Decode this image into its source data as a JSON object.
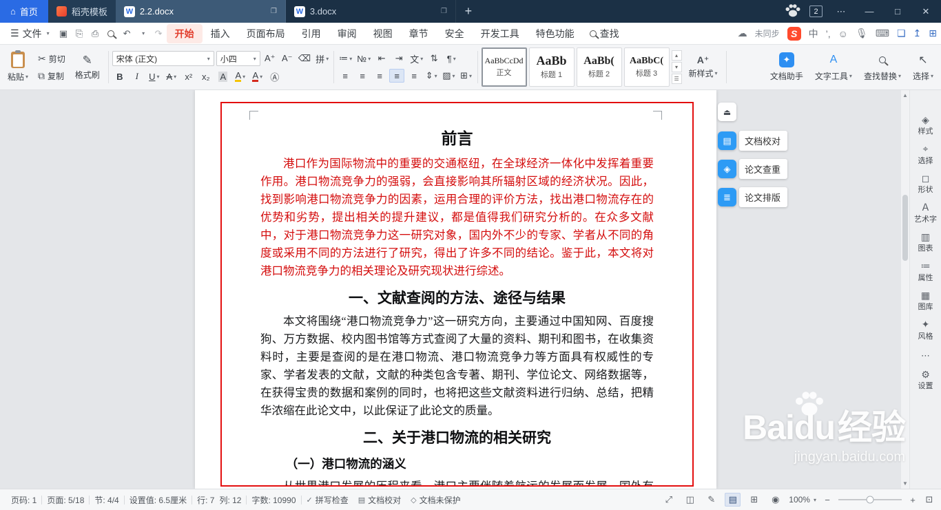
{
  "titlebar": {
    "home": "首页",
    "docer": "稻壳模板",
    "tabs": [
      {
        "label": "2.2.docx"
      },
      {
        "label": "3.docx"
      }
    ],
    "badge": "2"
  },
  "menubar": {
    "file": "文件",
    "tabs": [
      "开始",
      "插入",
      "页面布局",
      "引用",
      "审阅",
      "视图",
      "章节",
      "安全",
      "开发工具",
      "特色功能"
    ],
    "search": "查找",
    "sync": "未同步"
  },
  "ribbon": {
    "paste": "粘贴",
    "cut": "剪切",
    "copy": "复制",
    "format_painter": "格式刷",
    "font_name": "宋体 (正文)",
    "font_size": "小四",
    "styles": [
      {
        "preview": "AaBbCcDd",
        "label": "正文"
      },
      {
        "preview": "AaBb",
        "label": "标题 1"
      },
      {
        "preview": "AaBb(",
        "label": "标题 2"
      },
      {
        "preview": "AaBbC(",
        "label": "标题 3"
      }
    ],
    "new_style": "新样式",
    "doc_assistant": "文档助手",
    "text_tool": "文字工具",
    "find_replace": "查找替换",
    "select": "选择"
  },
  "document": {
    "title": "前言",
    "intro": "港口作为国际物流中的重要的交通枢纽，在全球经济一体化中发挥着重要作用。港口物流竞争力的强弱，会直接影响其所辐射区域的经济状况。因此，找到影响港口物流竞争力的因素，运用合理的评价方法，找出港口物流存在的优势和劣势，提出相关的提升建议，都是值得我们研究分析的。在众多文献中，对于港口物流竞争力这一研究对象，国内外不少的专家、学者从不同的角度或采用不同的方法进行了研究，得出了许多不同的结论。鉴于此，本文将对港口物流竞争力的相关理论及研究现状进行综述。",
    "heading1": "一、文献查阅的方法、途径与结果",
    "para1": "本文将围绕“港口物流竞争力”这一研究方向，主要通过中国知网、百度搜狗、万方数据、校内图书馆等方式查阅了大量的资料、期刊和图书，在收集资料时，主要是查阅的是在港口物流、港口物流竞争力等方面具有权威性的专家、学者发表的文献，文献的种类包含专著、期刊、学位论文、网络数据等，在获得宝贵的数据和案例的同时，也将把这些文献资料进行归纳、总结，把精华浓缩在此论文中，以此保证了此论文的质量。",
    "heading2": "二、关于港口物流的相关研究",
    "subheading1": "（一）港口物流的涵义",
    "partial_line": "从世界港口发展的历程来看，港口主要伴随着航运的发展而发展。国外有学"
  },
  "assist_panel": {
    "items": [
      "文档校对",
      "论文查重",
      "论文排版"
    ]
  },
  "right_rail": {
    "items": [
      "样式",
      "选择",
      "形状",
      "艺术字",
      "图表",
      "属性",
      "图库",
      "风格",
      "设置"
    ]
  },
  "statusbar": {
    "page_no": "页码: 1",
    "pages": "页面: 5/18",
    "section": "节: 4/4",
    "setting": "设置值: 6.5厘米",
    "line": "行: 7",
    "col": "列: 12",
    "words": "字数: 10990",
    "spellcheck": "拼写检查",
    "proofread": "文档校对",
    "protection": "文档未保护",
    "zoom": "100%"
  },
  "watermark": {
    "brand": "Baidu",
    "suffix": "经验",
    "url": "jingyan.baidu.com"
  }
}
